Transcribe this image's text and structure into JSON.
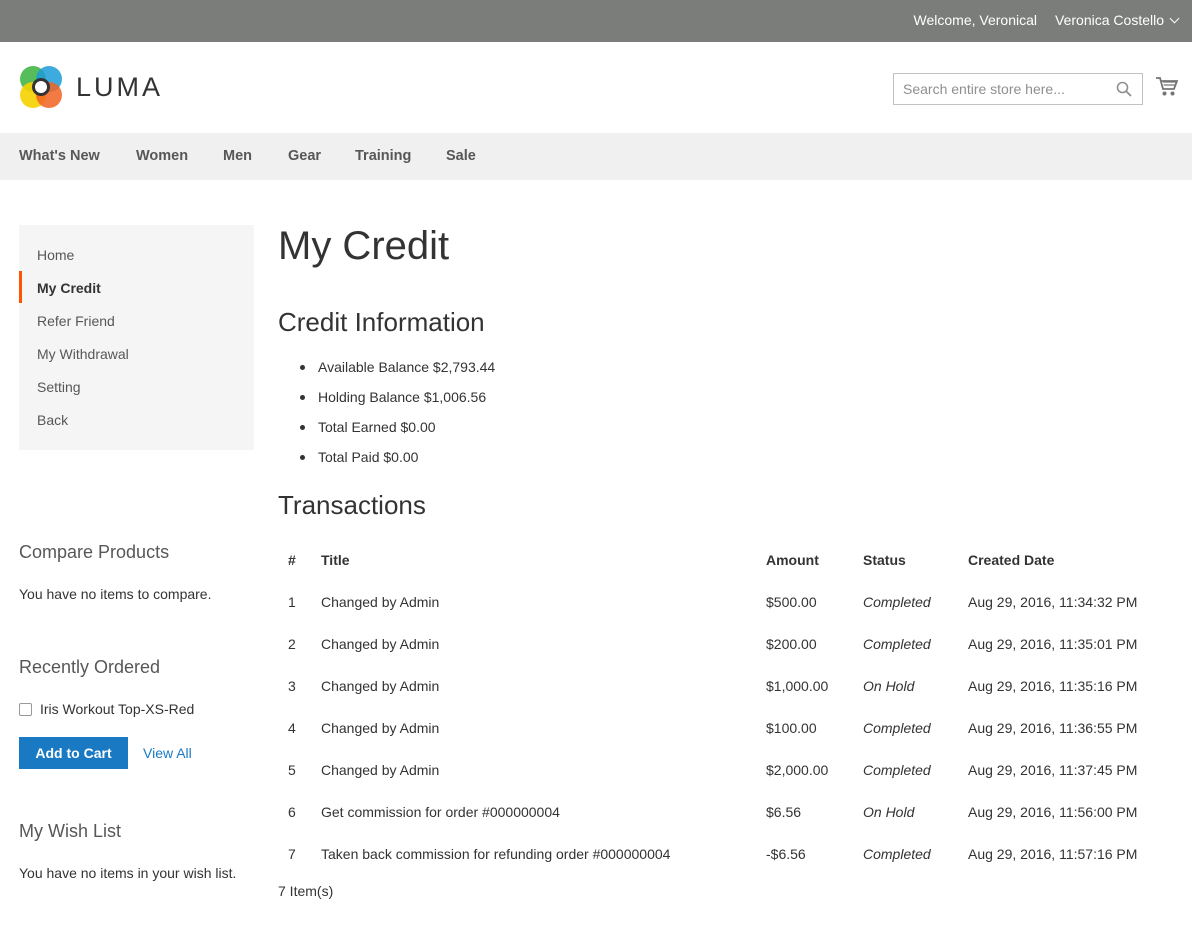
{
  "topbar": {
    "welcome": "Welcome, Veronical",
    "account": "Veronica Costello"
  },
  "header": {
    "logo_text": "LUMA",
    "search_placeholder": "Search entire store here..."
  },
  "nav": {
    "items": [
      "What's New",
      "Women",
      "Men",
      "Gear",
      "Training",
      "Sale"
    ]
  },
  "sidebar": {
    "items": [
      "Home",
      "My Credit",
      "Refer Friend",
      "My Withdrawal",
      "Setting",
      "Back"
    ],
    "active": "My Credit"
  },
  "compare": {
    "title": "Compare Products",
    "empty": "You have no items to compare."
  },
  "recently_ordered": {
    "title": "Recently Ordered",
    "item": "Iris Workout Top-XS-Red",
    "add_to_cart": "Add to Cart",
    "view_all": "View All"
  },
  "wishlist": {
    "title": "My Wish List",
    "empty": "You have no items in your wish list."
  },
  "main": {
    "title": "My Credit",
    "credit_title": "Credit Information",
    "credit_items": [
      "Available Balance $2,793.44",
      "Holding Balance $1,006.56",
      "Total Earned $0.00",
      "Total Paid $0.00"
    ],
    "transactions_title": "Transactions",
    "columns": [
      "#",
      "Title",
      "Amount",
      "Status",
      "Created Date"
    ],
    "rows": [
      {
        "num": "1",
        "title": "Changed by Admin",
        "amount": "$500.00",
        "status": "Completed",
        "date": "Aug 29, 2016, 11:34:32 PM"
      },
      {
        "num": "2",
        "title": "Changed by Admin",
        "amount": "$200.00",
        "status": "Completed",
        "date": "Aug 29, 2016, 11:35:01 PM"
      },
      {
        "num": "3",
        "title": "Changed by Admin",
        "amount": "$1,000.00",
        "status": "On Hold",
        "date": "Aug 29, 2016, 11:35:16 PM"
      },
      {
        "num": "4",
        "title": "Changed by Admin",
        "amount": "$100.00",
        "status": "Completed",
        "date": "Aug 29, 2016, 11:36:55 PM"
      },
      {
        "num": "5",
        "title": "Changed by Admin",
        "amount": "$2,000.00",
        "status": "Completed",
        "date": "Aug 29, 2016, 11:37:45 PM"
      },
      {
        "num": "6",
        "title": "Get commission for order #000000004",
        "amount": "$6.56",
        "status": "On Hold",
        "date": "Aug 29, 2016, 11:56:00 PM"
      },
      {
        "num": "7",
        "title": "Taken back commission for refunding order #000000004",
        "amount": "-$6.56",
        "status": "Completed",
        "date": "Aug 29, 2016, 11:57:16 PM"
      }
    ],
    "item_count": "7 Item(s)"
  }
}
